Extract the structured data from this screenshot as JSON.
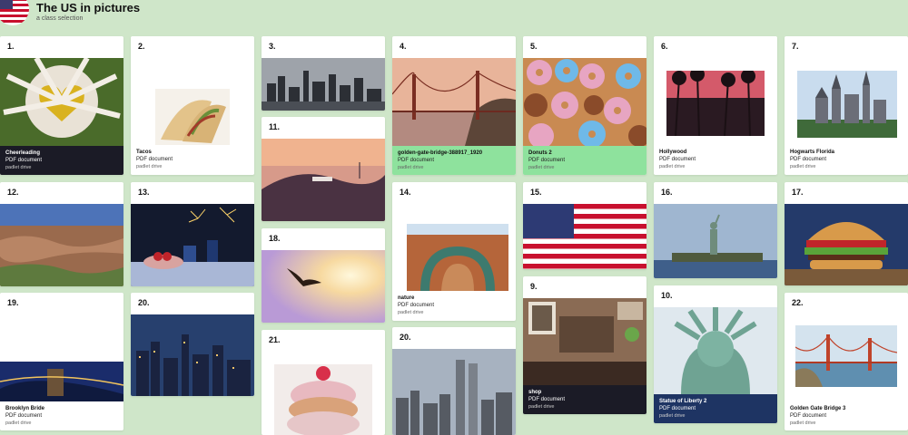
{
  "header": {
    "title": "The US in pictures",
    "subtitle": "a class selection",
    "avatar_icon": "us-flag-avatar-icon"
  },
  "cards": {
    "c1": {
      "num": "1.",
      "title": "Cheerleading",
      "type": "PDF document",
      "source": "padlet drive",
      "bar": "#1b1b26"
    },
    "c2": {
      "num": "2.",
      "title": "Tacos",
      "type": "PDF document",
      "source": "padlet drive"
    },
    "c3": {
      "num": "3."
    },
    "c4": {
      "num": "4.",
      "title": "golden-gate-bridge-388917_1920",
      "type": "PDF document",
      "source": "padlet drive",
      "bar": "#8ee29d"
    },
    "c5": {
      "num": "5.",
      "title": "Donuts 2",
      "type": "PDF document",
      "source": "padlet drive",
      "bar": "#8ee29d"
    },
    "c6": {
      "num": "6.",
      "title": "Hollywood",
      "type": "PDF document",
      "source": "padlet drive"
    },
    "c7": {
      "num": "7.",
      "title": "Hogwarts Florida",
      "type": "PDF document",
      "source": "padlet drive"
    },
    "c11": {
      "num": "11."
    },
    "c12": {
      "num": "12."
    },
    "c13": {
      "num": "13."
    },
    "c14": {
      "num": "14.",
      "title": "nature",
      "type": "PDF document",
      "source": "padlet drive"
    },
    "c15": {
      "num": "15."
    },
    "c16": {
      "num": "16."
    },
    "c17": {
      "num": "17."
    },
    "c18": {
      "num": "18."
    },
    "c19": {
      "num": "19.",
      "title": "Brooklyn Bride",
      "type": "PDF document",
      "source": "padlet drive"
    },
    "c20a": {
      "num": "20."
    },
    "c9": {
      "num": "9.",
      "title": "shop",
      "type": "PDF document",
      "source": "padlet drive",
      "bar": "#1b1b26"
    },
    "c10": {
      "num": "10.",
      "title": "Statue of Liberty 2",
      "type": "PDF document",
      "source": "padlet drive",
      "bar": "#1e3463"
    },
    "c21": {
      "num": "21."
    },
    "c20b": {
      "num": "20."
    },
    "c22": {
      "num": "22.",
      "title": "Golden Gate Bridge 3",
      "type": "PDF document",
      "source": "padlet drive"
    }
  }
}
